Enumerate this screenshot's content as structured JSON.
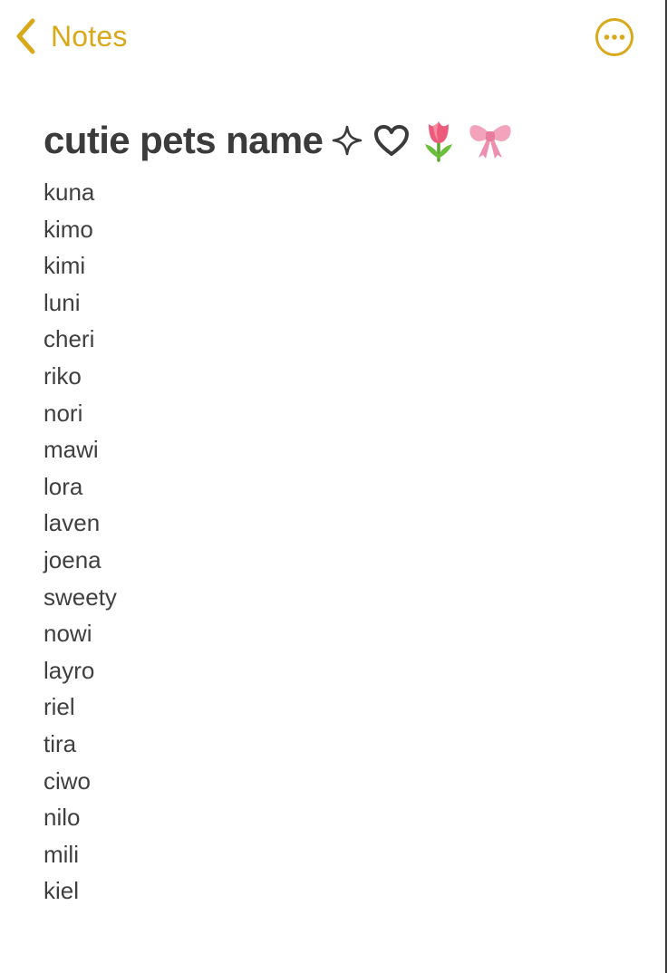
{
  "nav": {
    "back_label": "Notes",
    "back_icon": "chevron-left-icon",
    "more_icon": "ellipsis-circle-icon",
    "accent_color": "#d9a91c"
  },
  "note": {
    "title": "cutie pets name",
    "title_decorations": [
      "sparkle-icon",
      "heart-outline-icon",
      "tulip-emoji",
      "ribbon-emoji"
    ],
    "names": [
      "kuna",
      "kimo",
      "kimi",
      "luni",
      "cheri",
      "riko",
      "nori",
      "mawi",
      "lora",
      "laven",
      "joena",
      "sweety",
      "nowi",
      "layro",
      "riel",
      "tira",
      "ciwo",
      "nilo",
      "mili",
      "kiel"
    ]
  }
}
